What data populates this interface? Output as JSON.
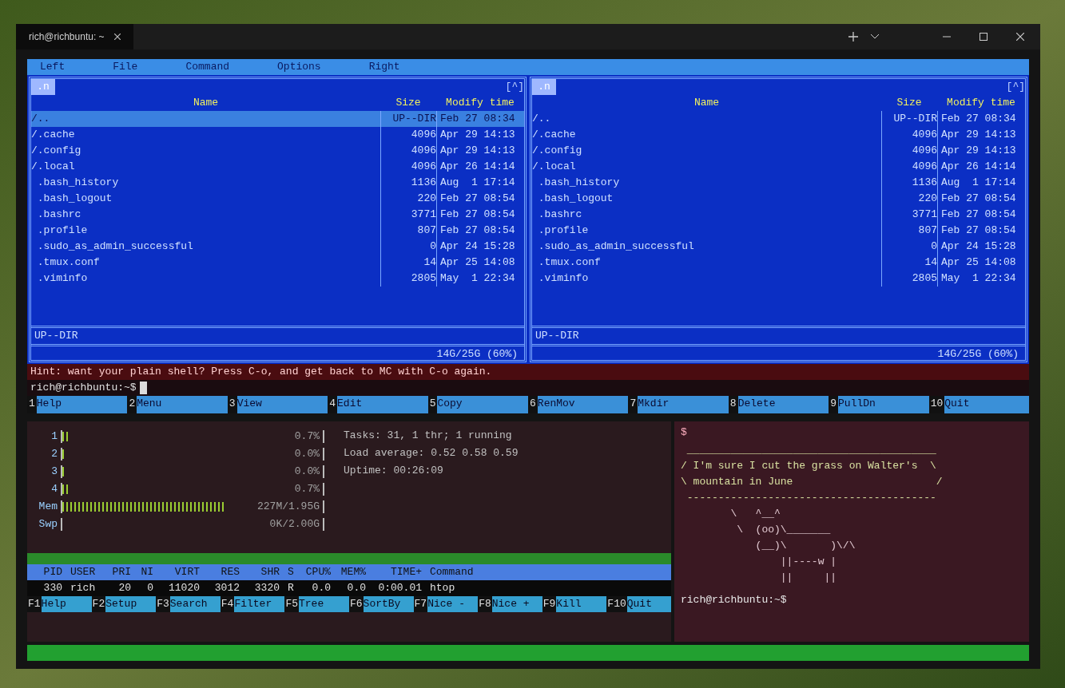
{
  "window": {
    "title": "rich@richbuntu: ~"
  },
  "mc": {
    "menu": [
      "Left",
      "File",
      "Command",
      "Options",
      "Right"
    ],
    "panels": [
      {
        "corner": "[^]",
        "columns": [
          "Name",
          "Size",
          "Modify time"
        ],
        "sort_mark": ".n",
        "rows": [
          {
            "name": "/..",
            "size": "UP--DIR",
            "modify": "Feb 27 08:34",
            "selected": true
          },
          {
            "name": "/.cache",
            "size": "4096",
            "modify": "Apr 29 14:13",
            "selected": false
          },
          {
            "name": "/.config",
            "size": "4096",
            "modify": "Apr 29 14:13",
            "selected": false
          },
          {
            "name": "/.local",
            "size": "4096",
            "modify": "Apr 26 14:14",
            "selected": false
          },
          {
            "name": " .bash_history",
            "size": "1136",
            "modify": "Aug  1 17:14",
            "selected": false
          },
          {
            "name": " .bash_logout",
            "size": "220",
            "modify": "Feb 27 08:54",
            "selected": false
          },
          {
            "name": " .bashrc",
            "size": "3771",
            "modify": "Feb 27 08:54",
            "selected": false
          },
          {
            "name": " .profile",
            "size": "807",
            "modify": "Feb 27 08:54",
            "selected": false
          },
          {
            "name": " .sudo_as_admin_successful",
            "size": "0",
            "modify": "Apr 24 15:28",
            "selected": false
          },
          {
            "name": " .tmux.conf",
            "size": "14",
            "modify": "Apr 25 14:08",
            "selected": false
          },
          {
            "name": " .viminfo",
            "size": "2805",
            "modify": "May  1 22:34",
            "selected": false
          }
        ],
        "status": "UP--DIR",
        "disk": "14G/25G (60%)"
      },
      {
        "corner": "[^]",
        "columns": [
          "Name",
          "Size",
          "Modify time"
        ],
        "sort_mark": ".n",
        "rows": [
          {
            "name": "/..",
            "size": "UP--DIR",
            "modify": "Feb 27 08:34",
            "selected": false
          },
          {
            "name": "/.cache",
            "size": "4096",
            "modify": "Apr 29 14:13",
            "selected": false
          },
          {
            "name": "/.config",
            "size": "4096",
            "modify": "Apr 29 14:13",
            "selected": false
          },
          {
            "name": "/.local",
            "size": "4096",
            "modify": "Apr 26 14:14",
            "selected": false
          },
          {
            "name": " .bash_history",
            "size": "1136",
            "modify": "Aug  1 17:14",
            "selected": false
          },
          {
            "name": " .bash_logout",
            "size": "220",
            "modify": "Feb 27 08:54",
            "selected": false
          },
          {
            "name": " .bashrc",
            "size": "3771",
            "modify": "Feb 27 08:54",
            "selected": false
          },
          {
            "name": " .profile",
            "size": "807",
            "modify": "Feb 27 08:54",
            "selected": false
          },
          {
            "name": " .sudo_as_admin_successful",
            "size": "0",
            "modify": "Apr 24 15:28",
            "selected": false
          },
          {
            "name": " .tmux.conf",
            "size": "14",
            "modify": "Apr 25 14:08",
            "selected": false
          },
          {
            "name": " .viminfo",
            "size": "2805",
            "modify": "May  1 22:34",
            "selected": false
          }
        ],
        "status": "UP--DIR",
        "disk": "14G/25G (60%)"
      }
    ],
    "hint": "Hint: want your plain shell? Press C-o, and get back to MC with C-o again.",
    "prompt": "rich@richbuntu:~$",
    "fkeys": [
      {
        "key": "1",
        "label": "Help"
      },
      {
        "key": "2",
        "label": "Menu"
      },
      {
        "key": "3",
        "label": "View"
      },
      {
        "key": "4",
        "label": "Edit"
      },
      {
        "key": "5",
        "label": "Copy"
      },
      {
        "key": "6",
        "label": "RenMov"
      },
      {
        "key": "7",
        "label": "Mkdir"
      },
      {
        "key": "8",
        "label": "Delete"
      },
      {
        "key": "9",
        "label": "PullDn"
      },
      {
        "key": "10",
        "label": "Quit"
      }
    ]
  },
  "htop": {
    "meters": [
      {
        "label": "1",
        "level": 0.02,
        "reading": "0.7%"
      },
      {
        "label": "2",
        "level": 0.01,
        "reading": "0.0%"
      },
      {
        "label": "3",
        "level": 0.01,
        "reading": "0.0%"
      },
      {
        "label": "4",
        "level": 0.02,
        "reading": "0.7%"
      },
      {
        "label": "Mem",
        "level": 0.62,
        "reading": "227M/1.95G"
      },
      {
        "label": "Swp",
        "level": 0.0,
        "reading": "0K/2.00G"
      }
    ],
    "info": [
      "Tasks: 31, 1 thr; 1 running",
      "Load average: 0.52 0.58 0.59",
      "Uptime: 00:26:09"
    ],
    "columns": [
      "PID",
      "USER",
      "PRI",
      "NI",
      "VIRT",
      "RES",
      "SHR",
      "S",
      "CPU%",
      "MEM%",
      "TIME+",
      "Command"
    ],
    "processes": [
      {
        "cells": [
          "330",
          "rich",
          "20",
          "0",
          "11020",
          "3012",
          "3320",
          "R",
          "0.0",
          "0.0",
          "0:00.01",
          "htop"
        ]
      }
    ],
    "fkeys": [
      {
        "key": "F1",
        "label": "Help"
      },
      {
        "key": "F2",
        "label": "Setup"
      },
      {
        "key": "F3",
        "label": "Search"
      },
      {
        "key": "F4",
        "label": "Filter"
      },
      {
        "key": "F5",
        "label": "Tree"
      },
      {
        "key": "F6",
        "label": "SortBy"
      },
      {
        "key": "F7",
        "label": "Nice -"
      },
      {
        "key": "F8",
        "label": "Nice +"
      },
      {
        "key": "F9",
        "label": "Kill"
      },
      {
        "key": "F10",
        "label": "Quit"
      }
    ]
  },
  "cowsay": {
    "command": "$",
    "speech": [
      " ________________________________________",
      "/ I'm sure I cut the grass on Walter's  \\",
      "\\ mountain in June                       /",
      " ----------------------------------------"
    ],
    "cow": [
      "        \\   ^__^",
      "         \\  (oo)\\_______",
      "            (__)\\       )\\/\\",
      "                ||----w |",
      "                ||     ||"
    ],
    "prompt": "rich@richbuntu:~$"
  }
}
